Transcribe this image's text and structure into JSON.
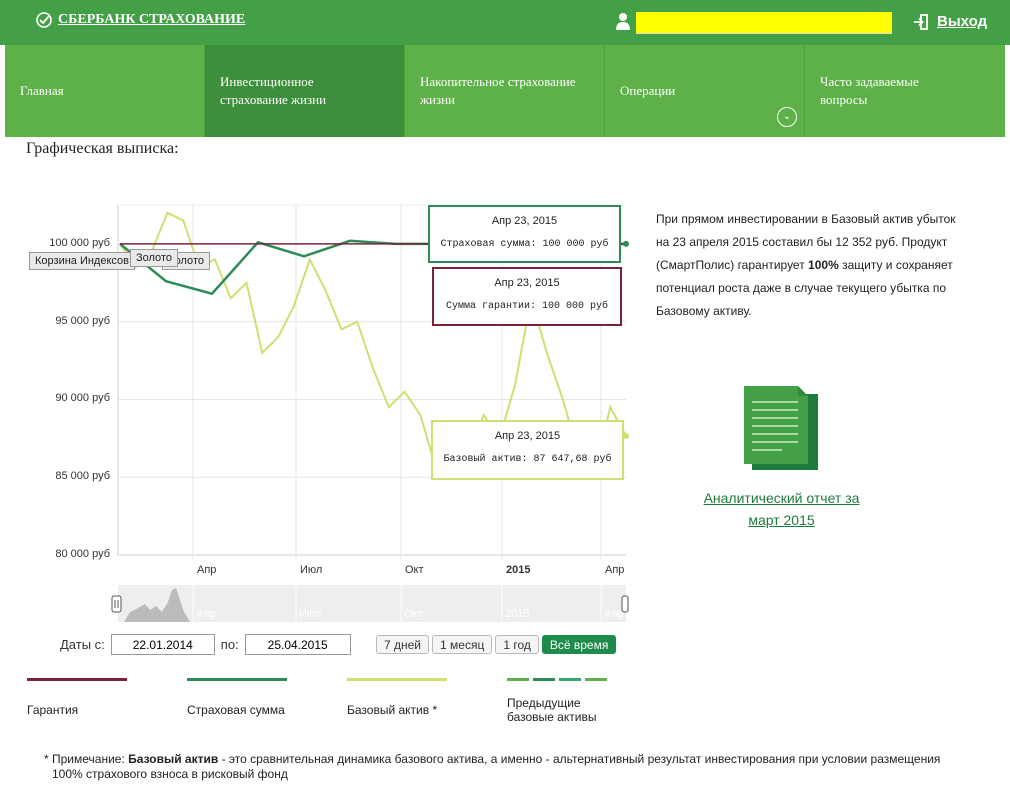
{
  "header": {
    "logo_text": "СБЕРБАНК СТРАХОВАНИЕ",
    "exit_label": "Выход"
  },
  "nav": {
    "items": [
      {
        "label": "Главная"
      },
      {
        "label": "Инвестиционное страхование жизни"
      },
      {
        "label": "Накопительное страхование жизни"
      },
      {
        "label": "Операции"
      },
      {
        "label": "Часто задаваемые вопросы"
      }
    ]
  },
  "page_title": "Графическая выписка:",
  "chart_data": {
    "type": "line",
    "x_ticks": [
      "Апр",
      "Июл",
      "Окт",
      "2015",
      "Апр"
    ],
    "y_ticks": [
      "100 000 руб",
      "95 000 руб",
      "90 000 руб",
      "85 000 руб",
      "80 000 руб"
    ],
    "ylim": [
      80000,
      102500
    ],
    "series": [
      {
        "name": "Гарантия",
        "color": "#7b2439",
        "values": [
          100000,
          100000
        ]
      },
      {
        "name": "Страховая сумма",
        "color": "#2e8b57",
        "values": [
          100000,
          97600,
          96800,
          100100,
          99200,
          100200,
          100000,
          100000,
          100000,
          100100,
          100000,
          100000
        ]
      },
      {
        "name": "Базовый актив *",
        "color": "#cde070",
        "values": [
          100000,
          98500,
          99500,
          102000,
          101500,
          98500,
          99000,
          96500,
          97500,
          93000,
          94000,
          96000,
          99000,
          97000,
          94500,
          95000,
          92000,
          89500,
          90500,
          89000,
          85500,
          88000,
          86500,
          89000,
          87500,
          91000,
          96500,
          93000,
          90000,
          86500,
          85000,
          89500,
          87650
        ]
      }
    ],
    "badges": [
      "Корзина Индексов",
      "Золото",
      "Золото"
    ],
    "tooltips": [
      {
        "date": "Апр 23, 2015",
        "text": "Страховая сумма: 100 000 руб"
      },
      {
        "date": "Апр 23, 2015",
        "text": "Сумма гарантии: 100 000 руб"
      },
      {
        "date": "Апр 23, 2015",
        "text": "Базовый актив: 87 647,68 руб"
      }
    ],
    "navigator_ticks": [
      "Апр",
      "Июл",
      "Окт",
      "2015",
      "Апр"
    ]
  },
  "range": {
    "from_label": "Даты с:",
    "from_value": "22.01.2014",
    "to_label": "по:",
    "to_value": "25.04.2015",
    "buttons": [
      "7 дней",
      "1 месяц",
      "1 год",
      "Всё время"
    ]
  },
  "legend": [
    {
      "label": "Гарантия",
      "color": "#7b2439"
    },
    {
      "label": "Страховая сумма",
      "color": "#2e8b57"
    },
    {
      "label": "Базовый актив *",
      "color": "#cde070"
    },
    {
      "label": "Предыдущие базовые активы",
      "colors": [
        "#5db148",
        "#2e8b57",
        "#33a870"
      ]
    }
  ],
  "info": {
    "text_1": "При прямом инвестировании в Базовый актив убыток на 23 апреля 2015 составил бы 12 352 руб. Продукт (СмартПолис) гарантирует ",
    "bold": "100%",
    "text_2": " защиту и сохраняет потенциал роста даже в случае текущего убытка по Базовому активу.",
    "report_link": "Аналитический отчет за март 2015"
  },
  "footnote": {
    "prefix": "* Примечание: ",
    "bold": "Базовый актив",
    "text_1": " - это сравнительная динамика базового актива, а именно - альтернативный результат инвестирования при условии размещения",
    "text_2": "100% страхового взноса в рисковый фонд"
  },
  "colors": {
    "header_bg": "#43a047",
    "nav_bg": "#5db148",
    "nav_active": "#3d8f3c",
    "accent": "#1e8b4a",
    "highlight": "#ffff00"
  }
}
